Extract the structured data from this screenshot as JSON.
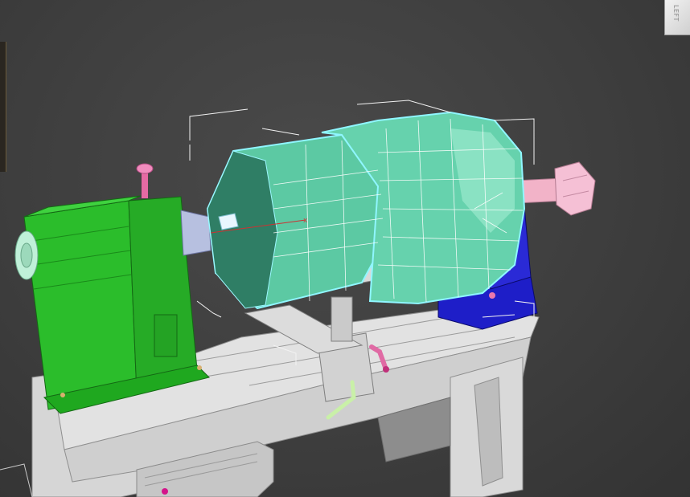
{
  "viewport": {
    "background": "#414141",
    "viewcube_face_label": "LEFT"
  },
  "colors": {
    "headstock": "#2bbd2b",
    "headstock_dark": "#1f8f1f",
    "chuck_selected": "#55c7a1",
    "chuck_light": "#7fe0bf",
    "selection_outline": "#8ff6ff",
    "tailstock_base": "#1c1cc9",
    "bed": "#d8d8d8",
    "bed_shadow": "#a9a9a9",
    "handle_pink": "#e978ad",
    "quill_pink": "#f2b3c8",
    "lever_green": "#c9f0a8",
    "wireframe": "#ffffff"
  },
  "icons": {
    "viewcube": "viewcube-icon",
    "pivot_gizmo": "transform-gizmo-icon"
  }
}
